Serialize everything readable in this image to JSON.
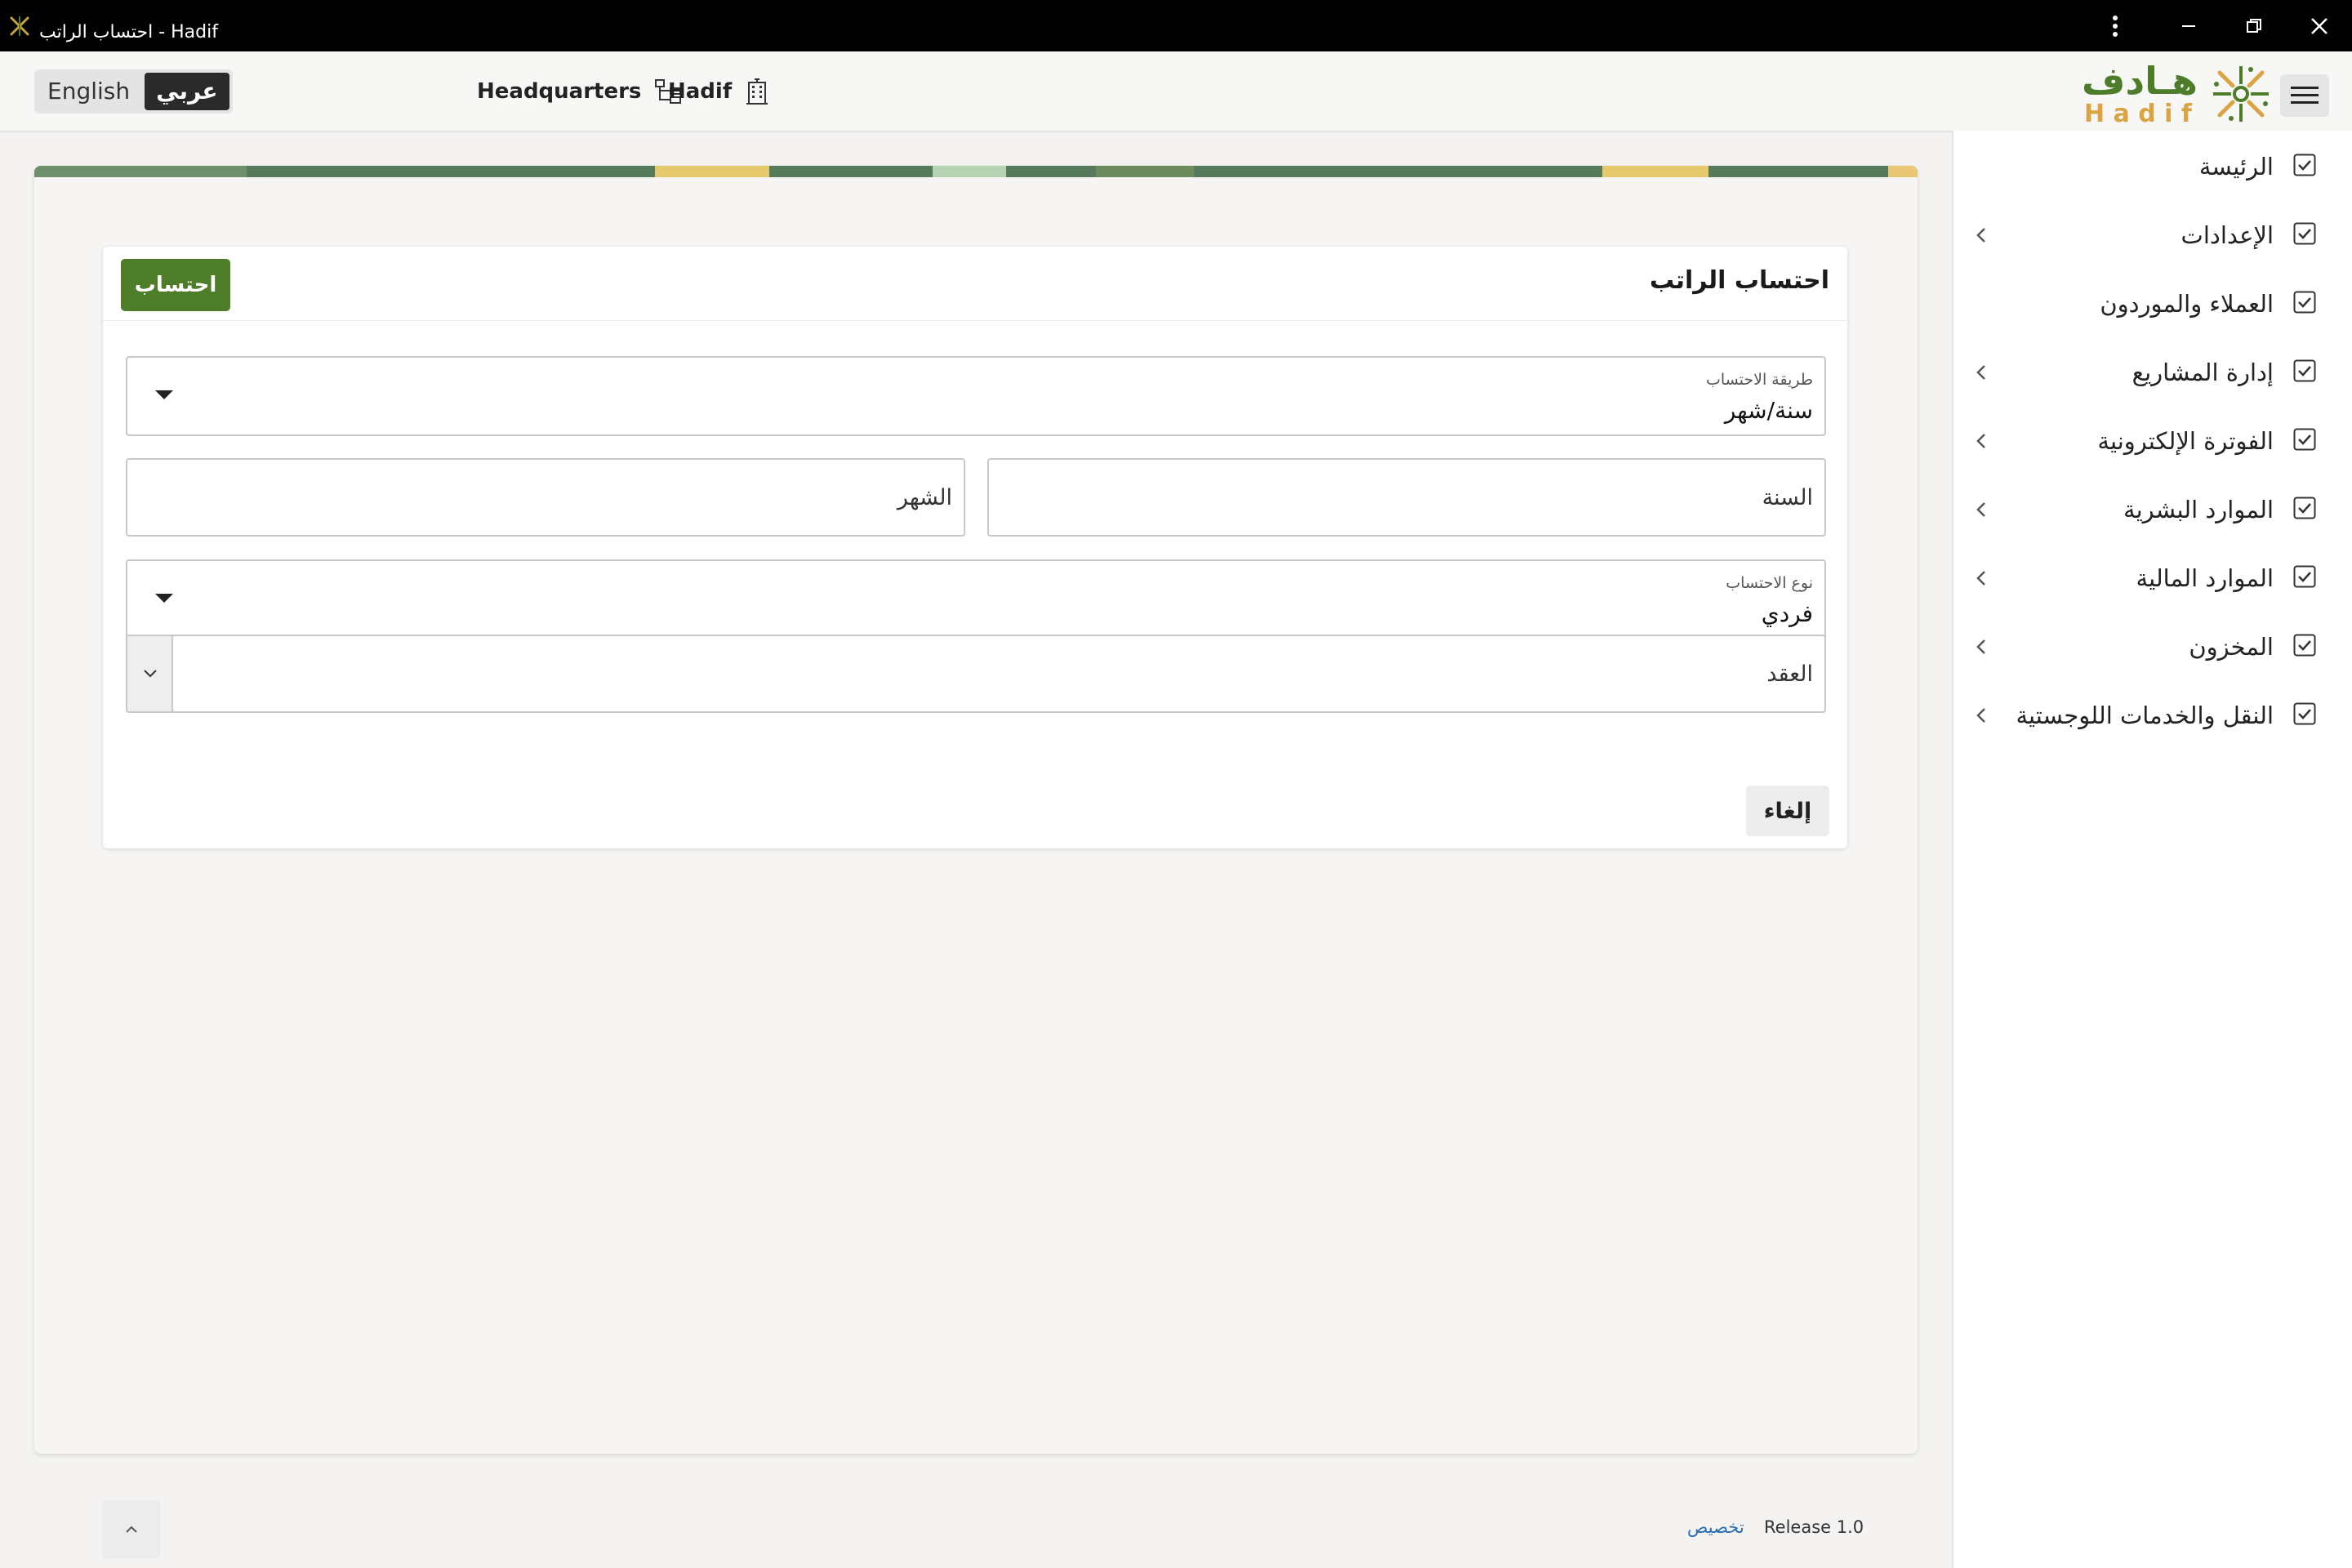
{
  "window": {
    "title": "احتساب الراتب - Hadif",
    "controls": [
      "more-icon",
      "minimize-icon",
      "restore-icon",
      "close-icon"
    ]
  },
  "header": {
    "lang_english": "English",
    "lang_arabic": "عربي",
    "org_headquarters": "Headquarters",
    "org_hadif": "Hadif",
    "brand_arabic": "هـادف",
    "brand_latin": "H a d i f",
    "colors": {
      "brand_green": "#4e7d2a",
      "brand_gold": "#d9a441"
    }
  },
  "sidebar": {
    "items": [
      {
        "label": "الرئيسة",
        "has_children": false
      },
      {
        "label": "الإعدادات",
        "has_children": true
      },
      {
        "label": "العملاء والموردون",
        "has_children": false
      },
      {
        "label": "إدارة المشاريع",
        "has_children": true
      },
      {
        "label": "الفوترة الإلكترونية",
        "has_children": true
      },
      {
        "label": "الموارد البشرية",
        "has_children": true
      },
      {
        "label": "الموارد المالية",
        "has_children": true
      },
      {
        "label": "المخزون",
        "has_children": true
      },
      {
        "label": "النقل والخدمات اللوجستية",
        "has_children": true
      }
    ]
  },
  "form": {
    "title": "احتساب الراتب",
    "calculate_button": "احتساب",
    "method_label": "طريقة الاحتساب",
    "method_value": "سنة/شهر",
    "year_placeholder": "السنة",
    "month_placeholder": "الشهر",
    "type_label": "نوع الاحتساب",
    "type_value": "فردي",
    "contract_placeholder": "العقد",
    "cancel_button": "إلغاء"
  },
  "footer": {
    "customize": "تخصيص",
    "release": "Release 1.0"
  }
}
